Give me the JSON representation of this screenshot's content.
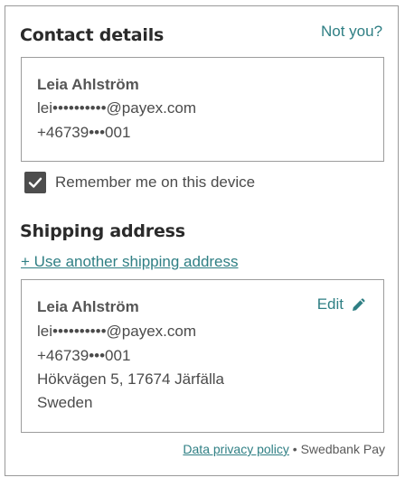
{
  "contact": {
    "heading": "Contact details",
    "not_you": "Not you?",
    "name": "Leia Ahlström",
    "email": "lei••••••••••@payex.com",
    "phone": "+46739•••001"
  },
  "remember": {
    "checked": true,
    "label": "Remember me on this device"
  },
  "shipping": {
    "heading": "Shipping address",
    "use_another": "+ Use another shipping address",
    "edit_label": "Edit",
    "name": "Leia Ahlström",
    "email": "lei••••••••••@payex.com",
    "phone": "+46739•••001",
    "street": "Hökvägen 5, 17674 Järfälla",
    "country": "Sweden"
  },
  "footer": {
    "privacy_link": "Data privacy policy",
    "separator": "•",
    "brand": "Swedbank Pay"
  },
  "colors": {
    "link": "#2f7f84",
    "checkbox": "#4d4d4d",
    "border": "#9c9c9c"
  },
  "icons": [
    "check-icon",
    "pencil-icon"
  ]
}
